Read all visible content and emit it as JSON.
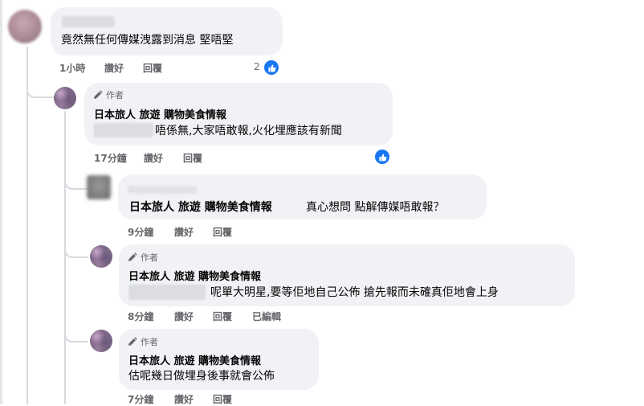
{
  "comments": [
    {
      "text": "竟然無任何傳媒洩露到消息 堅唔堅",
      "time": "1小時",
      "like": "讚好",
      "reply": "回覆",
      "reaction_count": "2"
    },
    {
      "author_badge": "作者",
      "name": "日本旅人 旅遊 購物美食情報",
      "text": "唔係無,大家唔敢報,火化埋應該有新聞",
      "time": "17分鐘",
      "like": "讚好",
      "reply": "回覆"
    },
    {
      "name": "日本旅人 旅遊 購物美食情報",
      "text": "真心想問 點解傳媒唔敢報？",
      "time": "9分鐘",
      "like": "讚好",
      "reply": "回覆"
    },
    {
      "author_badge": "作者",
      "name": "日本旅人 旅遊 購物美食情報",
      "text": "呢單大明星,要等佢地自己公佈 搶先報而未確真佢地會上身",
      "time": "8分鐘",
      "like": "讚好",
      "reply": "回覆",
      "edited": "已編輯"
    },
    {
      "author_badge": "作者",
      "name": "日本旅人 旅遊 購物美食情報",
      "text": "估呢幾日做埋身後事就會公佈",
      "time": "7分鐘",
      "like": "讚好",
      "reply": "回覆"
    }
  ],
  "colors": {
    "like_blue": "#1877f2",
    "bubble": "#f0f2f5",
    "meta_gray": "#65676b"
  },
  "icons": [
    "pencil-icon",
    "like-thumb-icon"
  ]
}
